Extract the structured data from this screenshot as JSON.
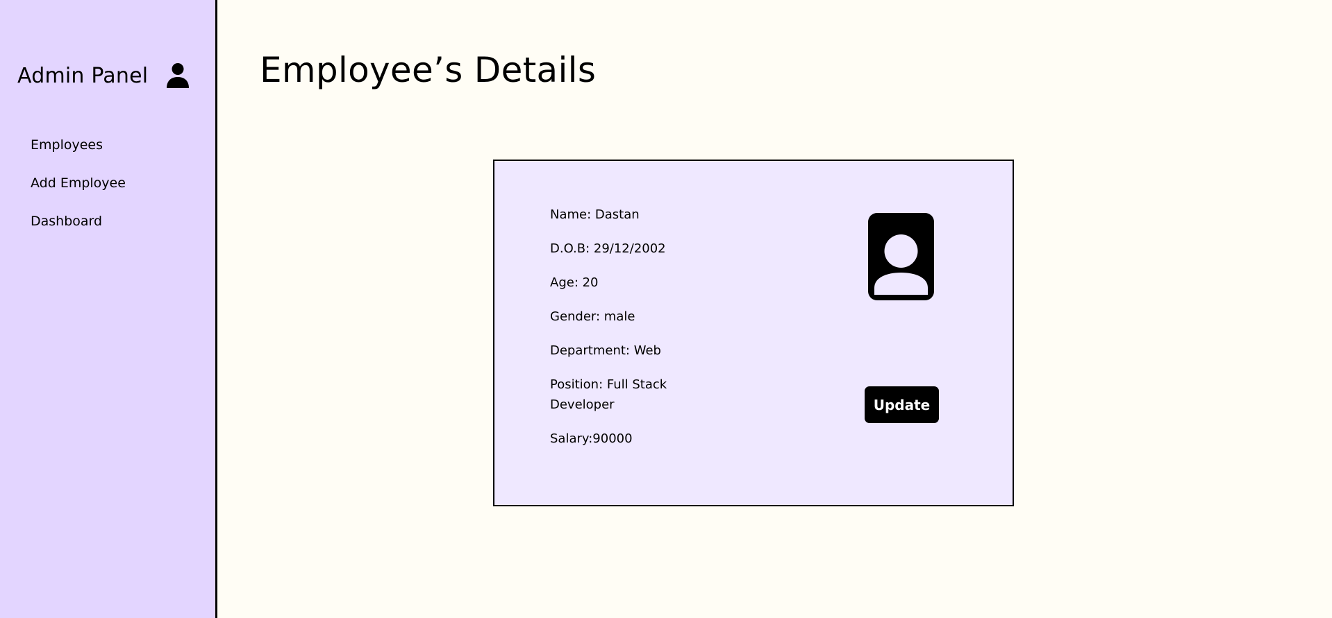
{
  "sidebar": {
    "title": "Admin Panel",
    "user_icon": "user-icon",
    "nav_items": [
      {
        "label": "Employees"
      },
      {
        "label": "Add Employee"
      },
      {
        "label": "Dashboard"
      }
    ]
  },
  "main": {
    "title": "Employee’s Details"
  },
  "employee_card": {
    "name": "Name: Dastan",
    "dob": "D.O.B: 29/12/2002",
    "age": "Age: 20",
    "gender": "Gender: male",
    "department": "Department: Web",
    "position": "Position: Full Stack Developer",
    "salary": "Salary:90000",
    "photo_icon": "id-badge-icon",
    "update_label": "Update"
  },
  "colors": {
    "sidebar_bg": "#e3d5ff",
    "page_bg": "#fffdf5",
    "card_bg": "#efe8ff",
    "button_bg": "#000000",
    "button_text": "#ffffff"
  }
}
